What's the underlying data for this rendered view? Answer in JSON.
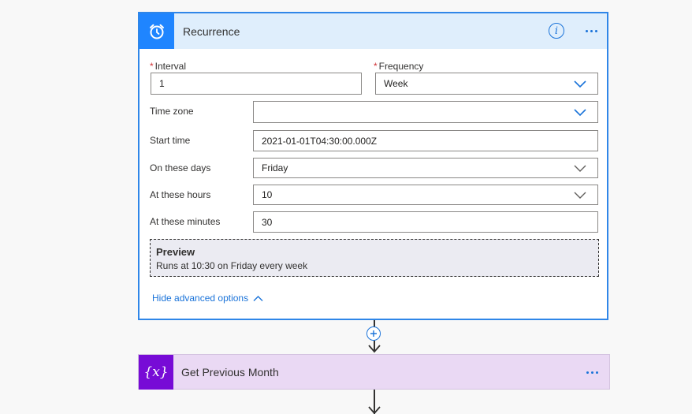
{
  "recurrence": {
    "title": "Recurrence",
    "interval": {
      "label": "Interval",
      "value": "1"
    },
    "frequency": {
      "label": "Frequency",
      "value": "Week"
    },
    "time_zone": {
      "label": "Time zone",
      "value": ""
    },
    "start_time": {
      "label": "Start time",
      "value": "2021-01-01T04:30:00.000Z"
    },
    "on_these_days": {
      "label": "On these days",
      "value": "Friday"
    },
    "at_these_hours": {
      "label": "At these hours",
      "value": "10"
    },
    "at_these_minutes": {
      "label": "At these minutes",
      "value": "30"
    },
    "preview": {
      "title": "Preview",
      "text": "Runs at 10:30 on Friday every week"
    },
    "hide_advanced": "Hide advanced options"
  },
  "next_step": {
    "title": "Get Previous Month"
  },
  "colors": {
    "accent": "#1a73d9",
    "recurrence_icon_bg": "#1f85ff",
    "variable_icon_bg": "#770bd6",
    "required": "#d13438"
  },
  "icons": {
    "recurrence": "alarm-clock-icon",
    "variable": "curly-x-icon"
  }
}
